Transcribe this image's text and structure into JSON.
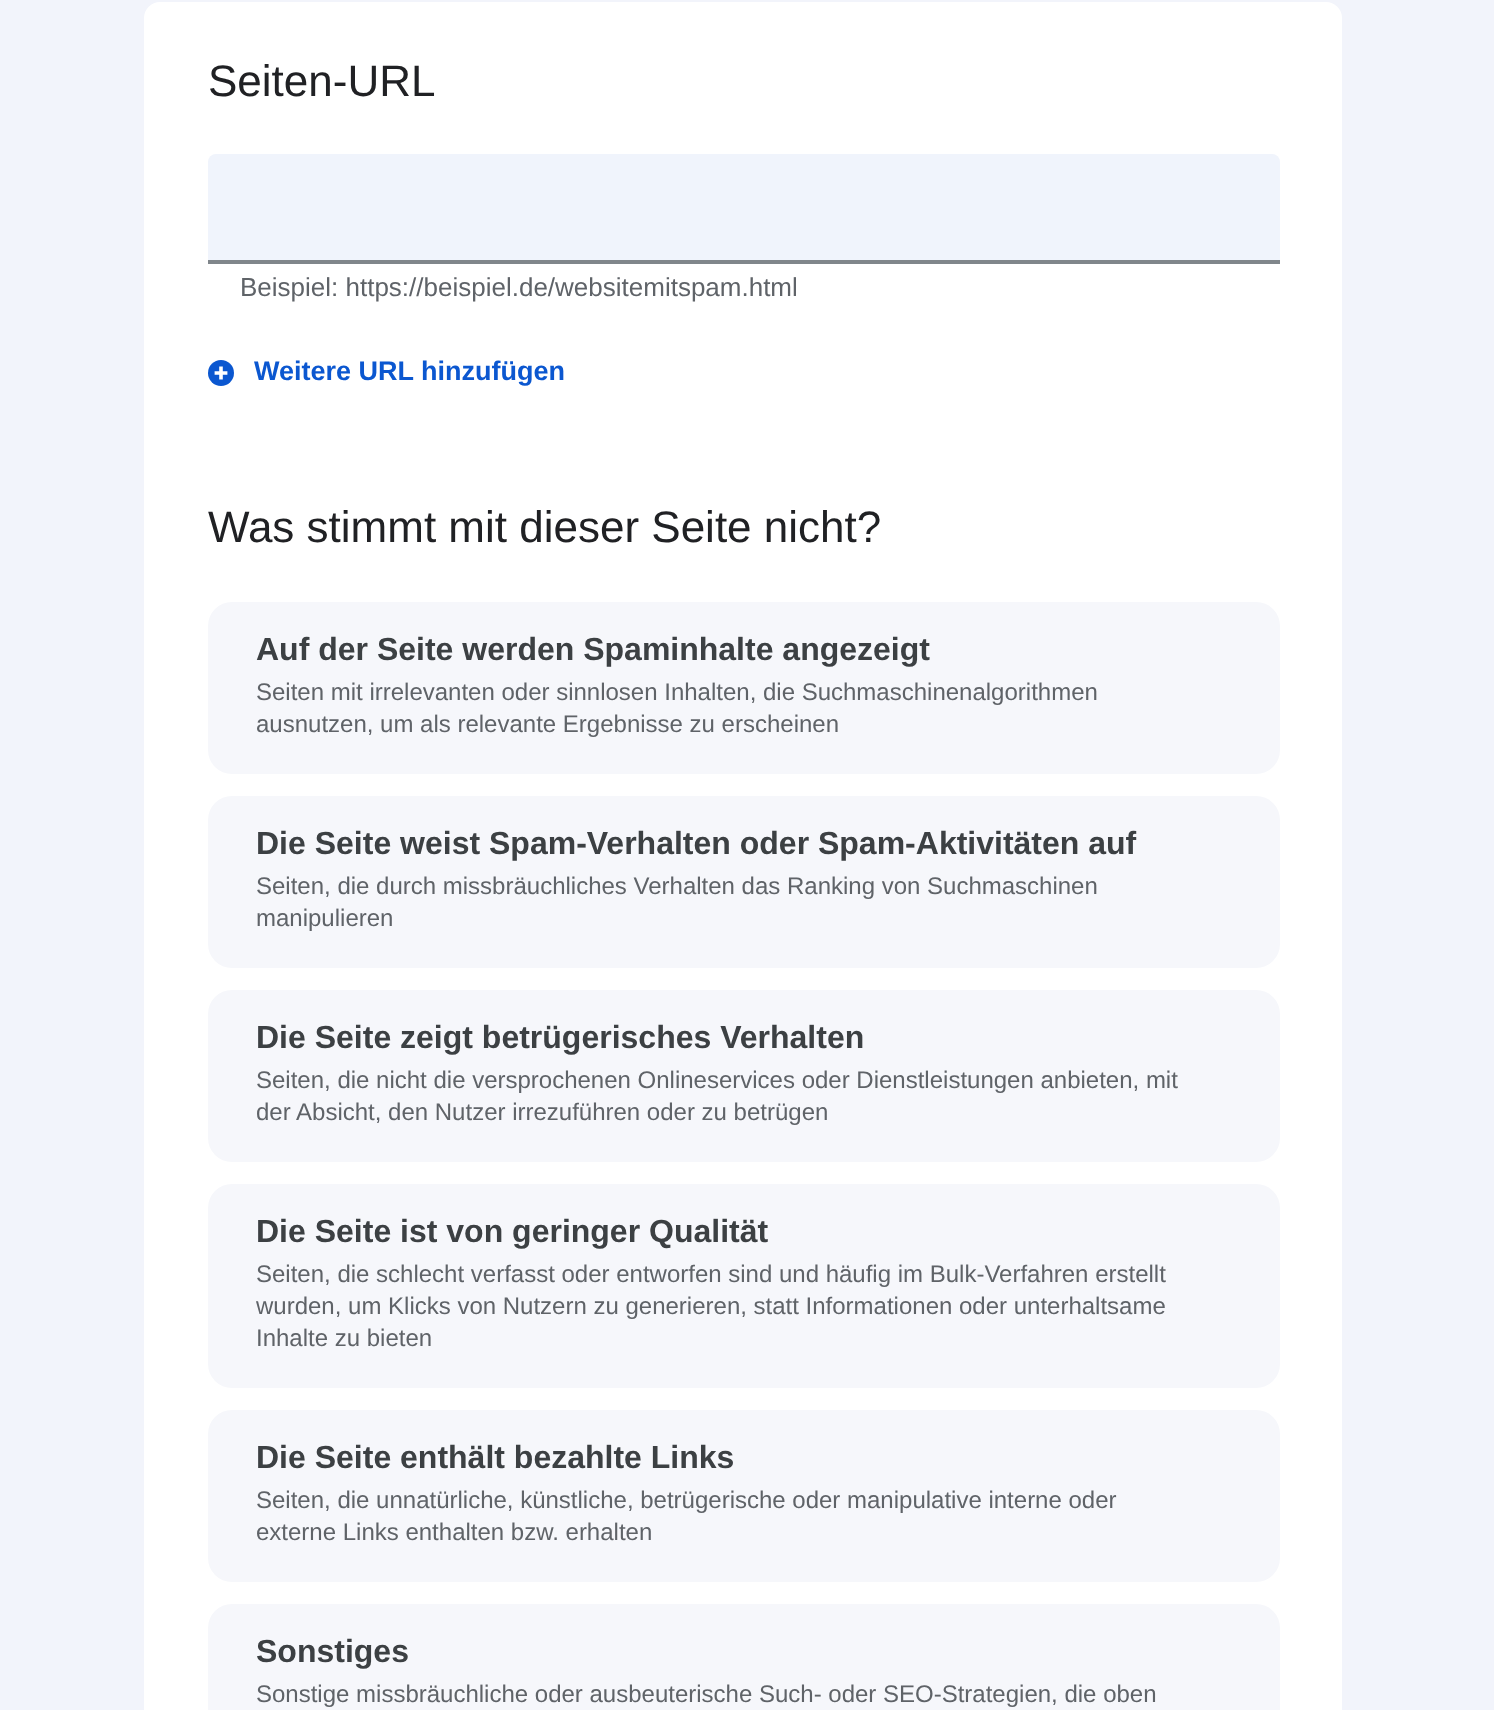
{
  "url_section": {
    "heading": "Seiten-URL",
    "url_field": {
      "helper": "Beispiel: https://beispiel.de/websitemitspam.html"
    },
    "add_link": "Weitere URL hinzufügen"
  },
  "problem_section": {
    "heading": "Was stimmt mit dieser Seite nicht?",
    "options": [
      {
        "title": "Auf der Seite werden Spaminhalte angezeigt",
        "description": "Seiten mit irrelevanten oder sinnlosen Inhalten, die Suchmaschinenalgorithmen ausnutzen, um als relevante Ergebnisse zu erscheinen"
      },
      {
        "title": "Die Seite weist Spam-Verhalten oder Spam-Aktivitäten auf",
        "description": "Seiten, die durch missbräuchliches Verhalten das Ranking von Suchmaschinen manipulieren"
      },
      {
        "title": "Die Seite zeigt betrügerisches Verhalten",
        "description": "Seiten, die nicht die versprochenen Onlineservices oder Dienstleistungen anbieten, mit der Absicht, den Nutzer irrezuführen oder zu betrügen"
      },
      {
        "title": "Die Seite ist von geringer Qualität",
        "description": "Seiten, die schlecht verfasst oder entworfen sind und häufig im Bulk-Verfahren erstellt wurden, um Klicks von Nutzern zu generieren, statt Informationen oder unterhaltsame Inhalte zu bieten"
      },
      {
        "title": "Die Seite enthält bezahlte Links",
        "description": "Seiten, die unnatürliche, künstliche, betrügerische oder manipulative interne oder externe Links enthalten bzw. erhalten"
      },
      {
        "title": "Sonstiges",
        "description": "Sonstige missbräuchliche oder ausbeuterische Such- oder SEO-Strategien, die oben"
      }
    ]
  }
}
